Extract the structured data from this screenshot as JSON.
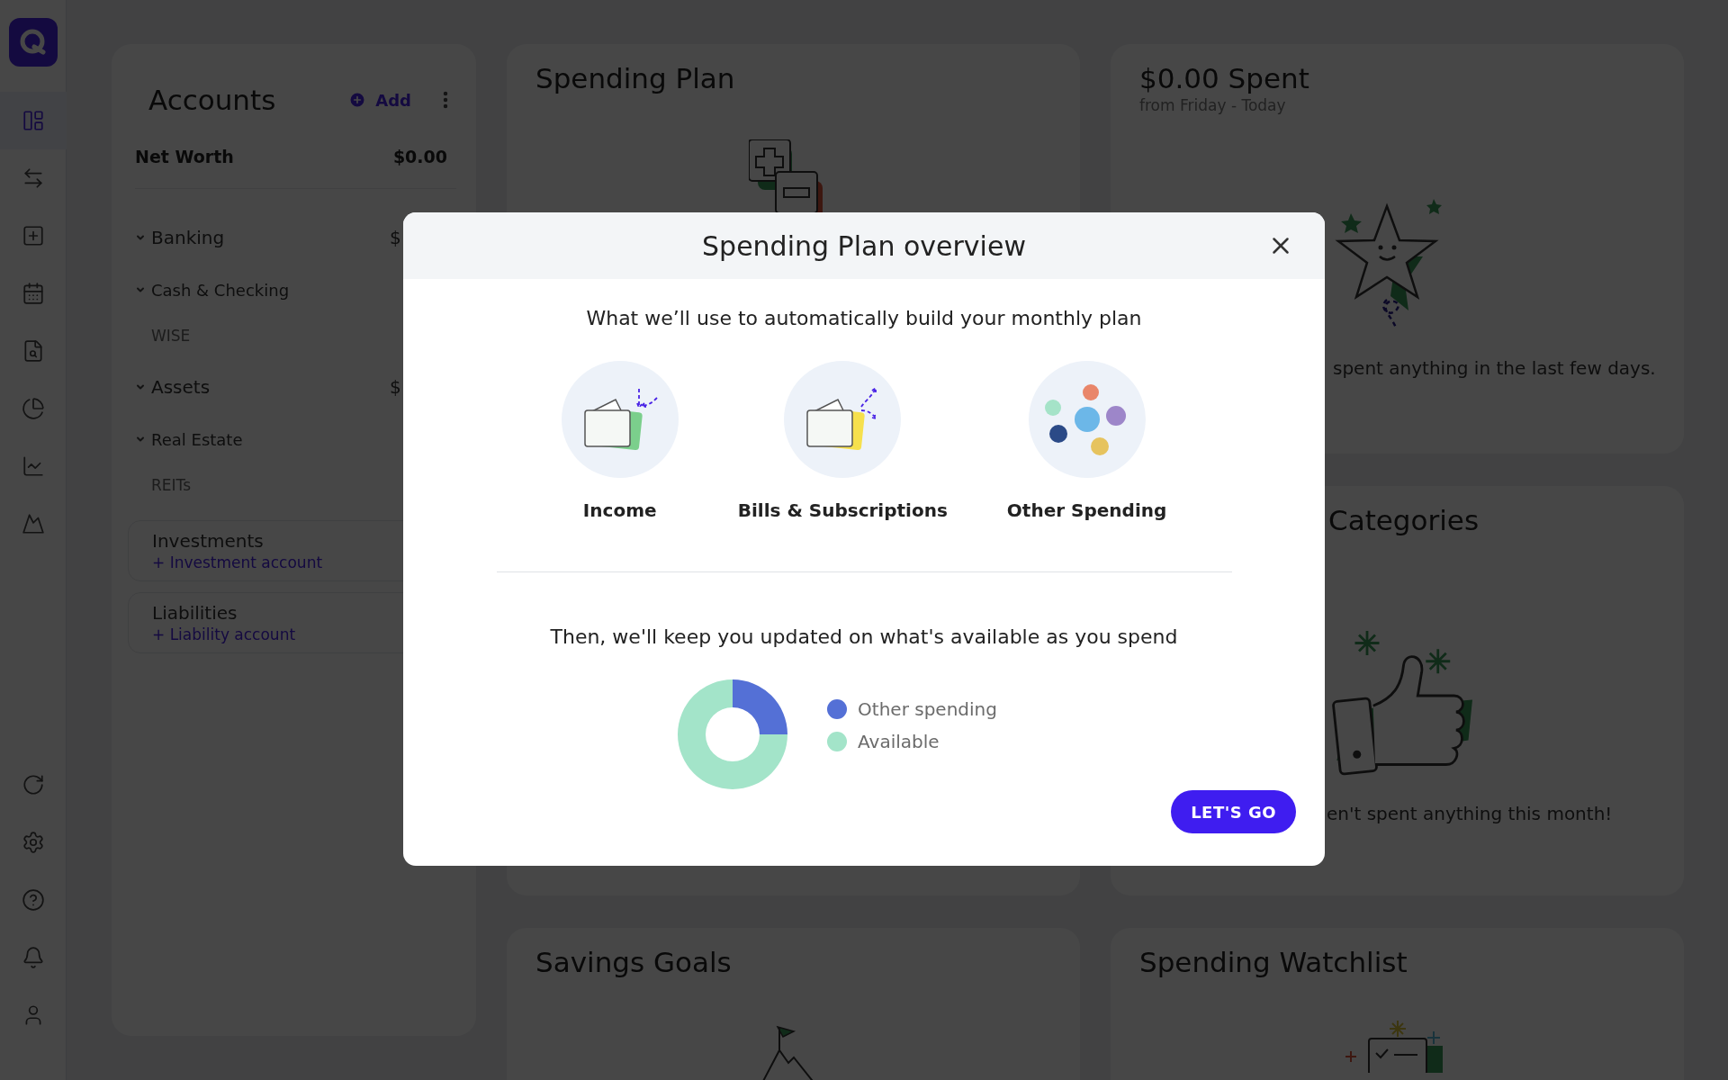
{
  "sidebar": {
    "nav_items": [
      {
        "selected": true
      },
      {
        "selected": false
      },
      {
        "selected": false
      },
      {
        "selected": false
      },
      {
        "selected": false
      },
      {
        "selected": false
      },
      {
        "selected": false
      },
      {
        "selected": false
      }
    ],
    "bottom_items": [
      {
        "selected": false
      },
      {
        "selected": false
      },
      {
        "selected": false
      },
      {
        "selected": false
      },
      {
        "selected": false
      }
    ]
  },
  "accounts": {
    "title": "Accounts",
    "add_label": "Add",
    "net_worth": {
      "label": "Net Worth",
      "value": "$0.00"
    },
    "groups": [
      {
        "label": "Banking",
        "value": "$",
        "expanded": true,
        "children": [
          {
            "label": "Cash & Checking",
            "expanded": true,
            "children": [
              {
                "label": "WISE"
              }
            ]
          }
        ]
      },
      {
        "label": "Assets",
        "value": "$",
        "expanded": true,
        "children": [
          {
            "label": "Real Estate",
            "expanded": true,
            "children": [
              {
                "label": "REITs"
              }
            ]
          }
        ]
      }
    ],
    "sections": [
      {
        "title": "Investments",
        "link": "+ Investment account"
      },
      {
        "title": "Liabilities",
        "link": "+ Liability account"
      }
    ]
  },
  "cards": [
    {
      "kind": "plan",
      "title": "Spending Plan"
    },
    {
      "kind": "spent",
      "title": "$0.00 Spent",
      "subtitle": "from Friday - Today",
      "message": "spent anything in the last few days."
    },
    {
      "kind": "categories",
      "title": "Categories",
      "message": "en't spent anything this month!"
    },
    {
      "kind": "goals",
      "title": "Savings Goals"
    },
    {
      "kind": "watchlist",
      "title": "Spending Watchlist"
    }
  ],
  "modal": {
    "title": "Spending Plan overview",
    "intro": "What we’ll use to automatically build your monthly plan",
    "sources": [
      {
        "kind": "income",
        "label": "Income"
      },
      {
        "kind": "bills",
        "label": "Bills & Subscriptions"
      },
      {
        "kind": "other",
        "label": "Other Spending"
      }
    ],
    "outro": "Then, we'll keep you updated on what's available as you spend",
    "legend": [
      {
        "label": "Other spending",
        "color": "#5470d6"
      },
      {
        "label": "Available",
        "color": "#a3e4c9"
      }
    ],
    "button": "LET'S GO"
  }
}
